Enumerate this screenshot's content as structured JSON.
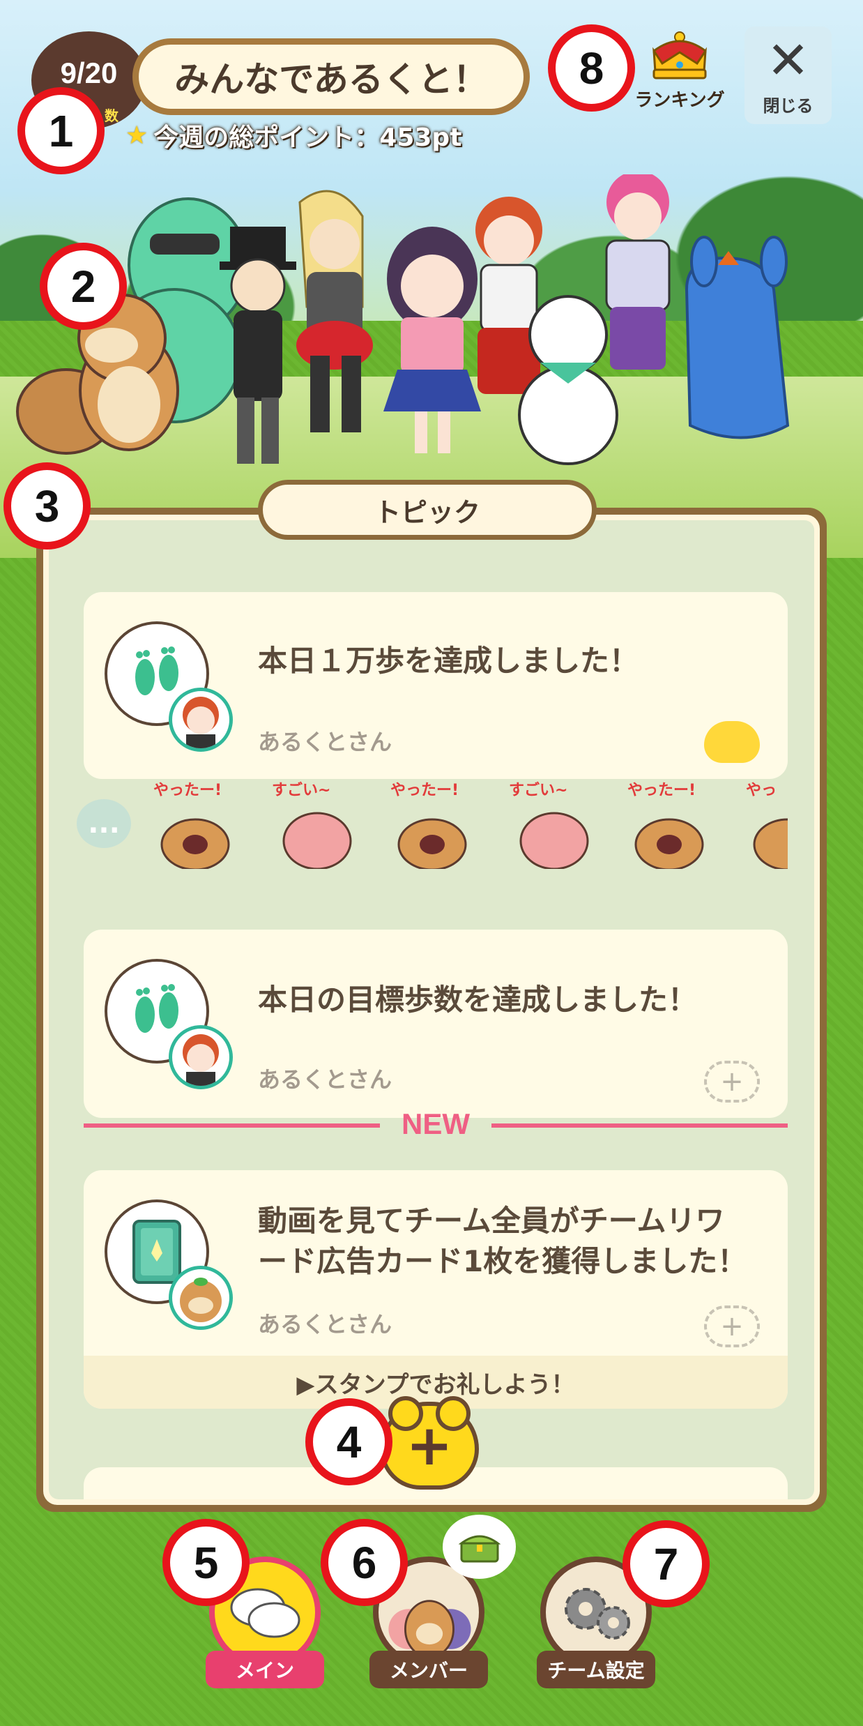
{
  "header": {
    "member_count": "9/20",
    "member_count_sub": "数",
    "team_name": "みんなであるくと！",
    "weekly_points_label": "今週の総ポイント：453pt",
    "ranking_label": "ランキング",
    "close_label": "閉じる"
  },
  "markers": [
    "1",
    "2",
    "3",
    "4",
    "5",
    "6",
    "7",
    "8"
  ],
  "topics": {
    "tab_label": "トピック",
    "new_label": "NEW",
    "items": [
      {
        "title": "本日１万歩を達成しました！",
        "user": "あるくとさん",
        "icon": "footprints-icon"
      },
      {
        "title": "本日の目標歩数を達成しました！",
        "user": "あるくとさん",
        "icon": "footprints-icon"
      },
      {
        "title_line1": "動画を見てチーム全員がチームリワ",
        "title_line2": "ード広告カード1枚を獲得しました！",
        "user": "あるくとさん",
        "icon": "reward-card-icon",
        "thanks_prompt": "▶スタンプでお礼しよう！"
      }
    ],
    "stamps": [
      "やったー!",
      "すごい~",
      "やったー!",
      "すごい~",
      "やったー!",
      "やっ"
    ],
    "more_label": "..."
  },
  "add_button": "+",
  "nav": {
    "main_label": "メイン",
    "members_label": "メンバー",
    "team_settings_label": "チーム設定"
  },
  "colors": {
    "marker_red": "#e8141b",
    "accent_pink": "#ef5f84",
    "main_active": "#e8406e",
    "nav_inactive": "#6b4530",
    "grass": "#6cb731"
  }
}
